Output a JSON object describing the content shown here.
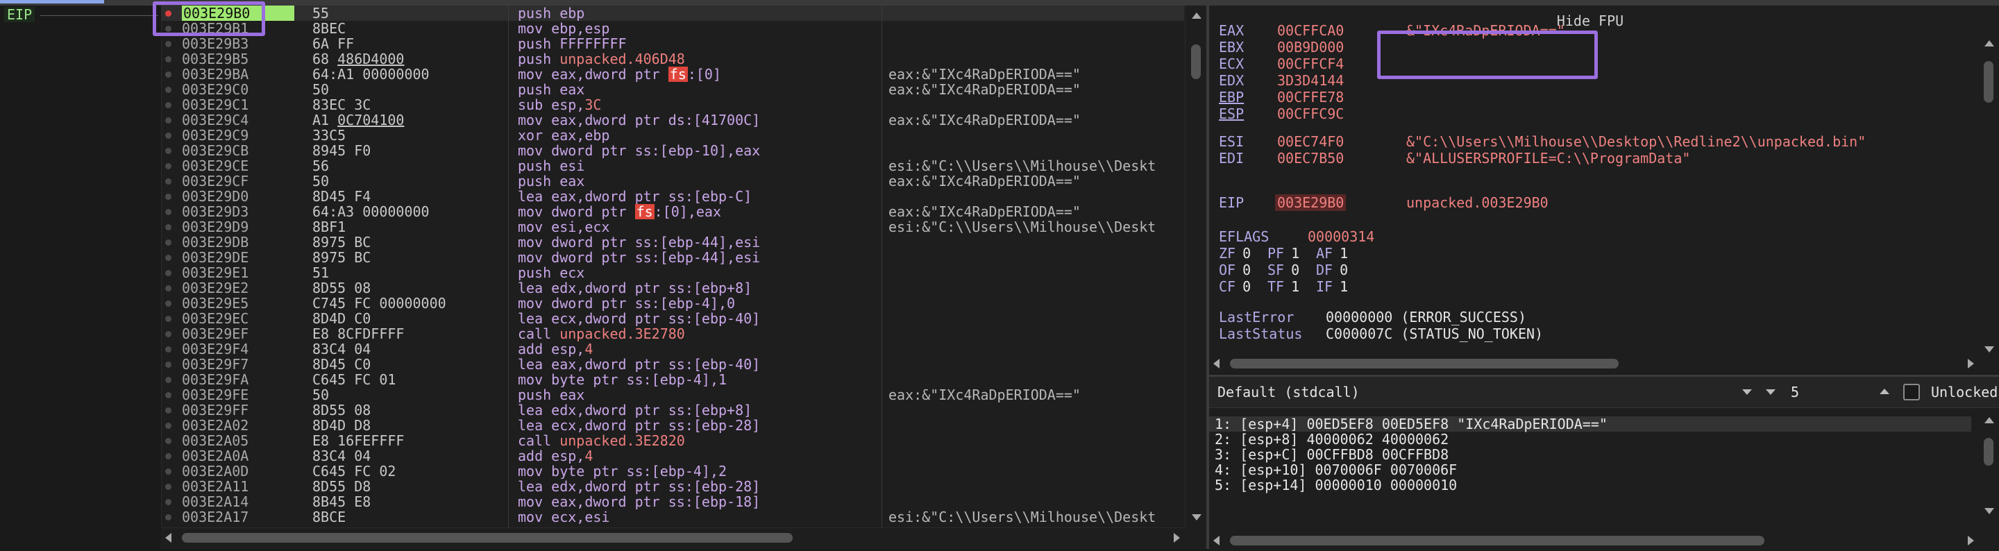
{
  "disasm": {
    "eip_label": "EIP",
    "rows": [
      {
        "addr": "003E29B0",
        "bytes": "55",
        "instr": "push ebp",
        "cmt": "",
        "current": true,
        "bp": true
      },
      {
        "addr": "003E29B1",
        "bytes": "8BEC",
        "instr": "mov ebp,esp",
        "cmt": ""
      },
      {
        "addr": "003E29B3",
        "bytes": "6A FF",
        "instr": "push FFFFFFFF",
        "cmt": ""
      },
      {
        "addr": "003E29B5",
        "bytes_a": "68 ",
        "bytes_u": "486D4000",
        "instr_a": "push ",
        "instr_sym": "unpacked.406D48",
        "cmt": ""
      },
      {
        "addr": "003E29BA",
        "bytes": "64:A1 00000000",
        "instr_a": "mov eax,dword ptr ",
        "instr_seg": "fs",
        "instr_b": ":[0]",
        "cmt": "eax:&\"IXc4RaDpERIODA==\""
      },
      {
        "addr": "003E29C0",
        "bytes": "50",
        "instr": "push eax",
        "cmt": "eax:&\"IXc4RaDpERIODA==\""
      },
      {
        "addr": "003E29C1",
        "bytes": "83EC 3C",
        "instr_a": "sub esp,",
        "instr_sym": "3C",
        "cmt": ""
      },
      {
        "addr": "003E29C4",
        "bytes_a": "A1 ",
        "bytes_u": "0C704100",
        "instr": "mov eax,dword ptr ds:[41700C]",
        "cmt": "eax:&\"IXc4RaDpERIODA==\""
      },
      {
        "addr": "003E29C9",
        "bytes": "33C5",
        "instr": "xor eax,ebp",
        "cmt": ""
      },
      {
        "addr": "003E29CB",
        "bytes": "8945 F0",
        "instr": "mov dword ptr ss:[ebp-10],eax",
        "cmt": ""
      },
      {
        "addr": "003E29CE",
        "bytes": "56",
        "instr": "push esi",
        "cmt": "esi:&\"C:\\\\Users\\\\Milhouse\\\\Deskt"
      },
      {
        "addr": "003E29CF",
        "bytes": "50",
        "instr": "push eax",
        "cmt": "eax:&\"IXc4RaDpERIODA==\""
      },
      {
        "addr": "003E29D0",
        "bytes": "8D45 F4",
        "instr": "lea eax,dword ptr ss:[ebp-C]",
        "cmt": ""
      },
      {
        "addr": "003E29D3",
        "bytes": "64:A3 00000000",
        "instr_a": "mov dword ptr ",
        "instr_seg": "fs",
        "instr_b": ":[0],eax",
        "cmt": "eax:&\"IXc4RaDpERIODA==\""
      },
      {
        "addr": "003E29D9",
        "bytes": "8BF1",
        "instr": "mov esi,ecx",
        "cmt": "esi:&\"C:\\\\Users\\\\Milhouse\\\\Deskt"
      },
      {
        "addr": "003E29DB",
        "bytes": "8975 BC",
        "instr": "mov dword ptr ss:[ebp-44],esi",
        "cmt": ""
      },
      {
        "addr": "003E29DE",
        "bytes": "8975 BC",
        "instr": "mov dword ptr ss:[ebp-44],esi",
        "cmt": ""
      },
      {
        "addr": "003E29E1",
        "bytes": "51",
        "instr": "push ecx",
        "cmt": ""
      },
      {
        "addr": "003E29E2",
        "bytes": "8D55 08",
        "instr": "lea edx,dword ptr ss:[ebp+8]",
        "cmt": ""
      },
      {
        "addr": "003E29E5",
        "bytes": "C745 FC 00000000",
        "instr": "mov dword ptr ss:[ebp-4],0",
        "cmt": ""
      },
      {
        "addr": "003E29EC",
        "bytes": "8D4D C0",
        "instr": "lea ecx,dword ptr ss:[ebp-40]",
        "cmt": ""
      },
      {
        "addr": "003E29EF",
        "bytes": "E8 8CFDFFFF",
        "instr_a": "call ",
        "instr_sym": "unpacked.3E2780",
        "cmt": ""
      },
      {
        "addr": "003E29F4",
        "bytes": "83C4 04",
        "instr_a": "add esp,",
        "instr_sym": "4",
        "cmt": ""
      },
      {
        "addr": "003E29F7",
        "bytes": "8D45 C0",
        "instr": "lea eax,dword ptr ss:[ebp-40]",
        "cmt": ""
      },
      {
        "addr": "003E29FA",
        "bytes": "C645 FC 01",
        "instr": "mov byte ptr ss:[ebp-4],1",
        "cmt": ""
      },
      {
        "addr": "003E29FE",
        "bytes": "50",
        "instr": "push eax",
        "cmt": "eax:&\"IXc4RaDpERIODA==\""
      },
      {
        "addr": "003E29FF",
        "bytes": "8D55 08",
        "instr": "lea edx,dword ptr ss:[ebp+8]",
        "cmt": ""
      },
      {
        "addr": "003E2A02",
        "bytes": "8D4D D8",
        "instr": "lea ecx,dword ptr ss:[ebp-28]",
        "cmt": ""
      },
      {
        "addr": "003E2A05",
        "bytes": "E8 16FEFFFF",
        "instr_a": "call ",
        "instr_sym": "unpacked.3E2820",
        "cmt": ""
      },
      {
        "addr": "003E2A0A",
        "bytes": "83C4 04",
        "instr_a": "add esp,",
        "instr_sym": "4",
        "cmt": ""
      },
      {
        "addr": "003E2A0D",
        "bytes": "C645 FC 02",
        "instr": "mov byte ptr ss:[ebp-4],2",
        "cmt": ""
      },
      {
        "addr": "003E2A11",
        "bytes": "8D55 D8",
        "instr": "lea edx,dword ptr ss:[ebp-28]",
        "cmt": ""
      },
      {
        "addr": "003E2A14",
        "bytes": "8B45 E8",
        "instr": "mov eax,dword ptr ss:[ebp-18]",
        "cmt": ""
      },
      {
        "addr": "003E2A17",
        "bytes": "8BCE",
        "instr": "mov ecx,esi",
        "cmt": "esi:&\"C:\\\\Users\\\\Milhouse\\\\Deskt"
      }
    ]
  },
  "registers": {
    "hide_fpu": "Hide FPU",
    "gp": [
      {
        "name": "EAX",
        "value": "00CFFCA0",
        "comment": "&\"IXc4RaDpERIODA==\""
      },
      {
        "name": "EBX",
        "value": "00B9D000",
        "comment": ""
      },
      {
        "name": "ECX",
        "value": "00CFFCF4",
        "comment": ""
      },
      {
        "name": "EDX",
        "value": "3D3D4144",
        "comment": ""
      },
      {
        "name": "EBP",
        "value": "00CFFE78",
        "comment": "",
        "underline": true
      },
      {
        "name": "ESP",
        "value": "00CFFC9C",
        "comment": "",
        "underline": true
      },
      {
        "name": "ESI",
        "value": "00EC74F0",
        "comment": "&\"C:\\\\Users\\\\Milhouse\\\\Desktop\\\\Redline2\\\\unpacked.bin\""
      },
      {
        "name": "EDI",
        "value": "00EC7B50",
        "comment": "&\"ALLUSERSPROFILE=C:\\\\ProgramData\""
      }
    ],
    "eip": {
      "name": "EIP",
      "value": "003E29B0",
      "comment": "unpacked.003E29B0"
    },
    "eflags": {
      "name": "EFLAGS",
      "value": "00000314"
    },
    "flags": [
      [
        {
          "n": "ZF",
          "v": "0"
        },
        {
          "n": "PF",
          "v": "1"
        },
        {
          "n": "AF",
          "v": "1"
        }
      ],
      [
        {
          "n": "OF",
          "v": "0"
        },
        {
          "n": "SF",
          "v": "0"
        },
        {
          "n": "DF",
          "v": "0"
        }
      ],
      [
        {
          "n": "CF",
          "v": "0"
        },
        {
          "n": "TF",
          "v": "1"
        },
        {
          "n": "IF",
          "v": "1"
        }
      ]
    ],
    "last_error": {
      "name": "LastError",
      "value": "00000000 (ERROR_SUCCESS)"
    },
    "last_status": {
      "name": "LastStatus",
      "value": "C000007C (STATUS_NO_TOKEN)"
    }
  },
  "stack": {
    "convention": "Default (stdcall)",
    "arg_count": "5",
    "unlocked_label": "Unlocked",
    "args": [
      "1: [esp+4] 00ED5EF8 00ED5EF8 \"IXc4RaDpERIODA==\"",
      "2: [esp+8] 40000062 40000062",
      "3: [esp+C] 00CFFBD8 00CFFBD8",
      "4: [esp+10] 0070006F 0070006F",
      "5: [esp+14] 00000010 00000010"
    ]
  },
  "colors": {
    "highlight_box": "#9b6fe0",
    "current_address": "#9fe870",
    "register_value": "#ef8080",
    "register_name": "#b4a8e6"
  }
}
